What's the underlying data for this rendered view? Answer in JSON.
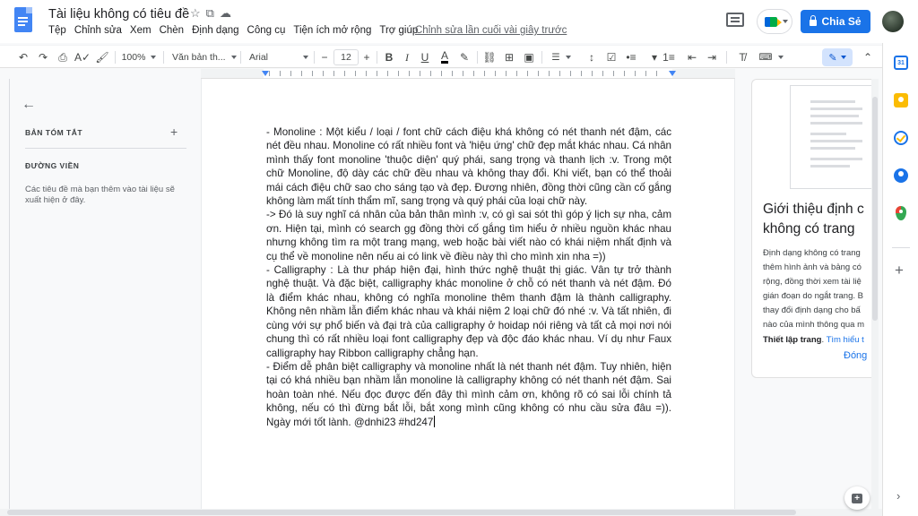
{
  "app": {
    "doc_title": "Tài liệu không có tiêu đề",
    "last_edit": "Chỉnh sửa lần cuối vài giây trước",
    "share_label": "Chia Sẻ"
  },
  "menu": [
    "Tệp",
    "Chỉnh sửa",
    "Xem",
    "Chèn",
    "Định dạng",
    "Công cụ",
    "Tiện ích mở rộng",
    "Trợ giúp"
  ],
  "toolbar": {
    "zoom": "100%",
    "style": "Văn bản th...",
    "font": "Arial",
    "font_size": "12",
    "minus": "−",
    "plus": "+"
  },
  "outline": {
    "summary_label": "BẢN TÓM TẮT",
    "outline_label": "ĐƯỜNG VIỀN",
    "outline_hint": "Các tiêu đề mà bạn thêm vào tài liệu sẽ xuất hiện ở đây."
  },
  "document": {
    "paragraphs": [
      "-      Monoline : Một kiểu / loại / font chữ cách điệu khá không có nét thanh nét đậm, các nét đều nhau. Monoline có rất nhiều font và 'hiệu ứng' chữ đẹp mắt khác nhau. Cá nhân mình thấy font monoline 'thuộc diện' quý phái, sang trọng và thanh lịch :v. Trong một chữ Monoline, độ dày các chữ đều nhau và không thay đổi. Khi viết, bạn có thể thoải mái cách điệu chữ sao cho sáng tạo và đẹp. Đương nhiên, đồng thời cũng cần cố gắng không làm mất tính thẩm mĩ, sang trọng và quý phái của loại chữ này.",
      "-> Đó là suy nghĩ cá nhân của bản thân mình :v, có gì sai sót thì góp ý lịch sự nha, cảm ơn. Hiện tại, mình có search gg đồng thời cố gắng tìm hiểu ở nhiều nguồn khác nhau nhưng không tìm ra một trang mạng, web hoặc bài viết nào có khái niệm nhất định và cụ thể về monoline nên nếu ai có link về điều này thì cho mình xin nha =))",
      "- Calligraphy : Là thư pháp hiện đại, hình thức nghệ thuật thị giác. Vân tự trở thành nghệ thuật. Và đặc biệt, calligraphy khác monoline ở chỗ có nét thanh và nét đậm. Đó là điểm khác nhau, không có nghĩa monoline thêm thanh đậm là thành calligraphy. Không nên nhầm lẫn điểm khác nhau và khái niệm 2 loại chữ đó nhé :v. Và tất nhiên, đi cùng với sự phổ biến và đại trà của calligraphy ở hoidap nói riêng và tất cả mọi nơi nói chung thì có rất nhiều loại font calligraphy đẹp và độc đáo khác nhau. Ví dụ như Faux calligraphy hay Ribbon calligraphy chẳng hạn.",
      "- Điểm dễ phân biệt calligraphy và monoline nhất là nét thanh nét đậm. Tuy nhiên, hiện tại có khá nhiều bạn nhầm lẫn monoline là calligraphy không có nét thanh nét đậm. Sai hoàn toàn nhé. Nếu đọc được đến đây thì mình cảm ơn, không rõ có sai lỗi chính tả không, nếu có thì đừng bắt lỗi, bắt xong mình cũng không có nhu cầu sửa đâu =)). Ngày mới tốt lành. @dnhi23 #hd247"
    ]
  },
  "explore": {
    "title_line1": "Giới thiệu định c",
    "title_line2": "không có trang",
    "desc_lines": [
      "Định dạng không có trang",
      "thêm hình ảnh và bảng có",
      "rộng, đồng thời xem tài liệ",
      "gián đoạn do ngắt trang. B",
      "thay đổi định dạng cho bấ",
      "nào của mình thông qua m"
    ],
    "desc_bold": "Thiết lập trang",
    "desc_link": "Tìm hiểu t",
    "close_label": "Đóng"
  },
  "sidebar": {
    "calendar_label": "31"
  },
  "colors": {
    "accent": "#1a73e8",
    "share_bg": "#1a73e8",
    "page_bg": "#ffffff",
    "canvas_bg": "#f8f9fa"
  }
}
